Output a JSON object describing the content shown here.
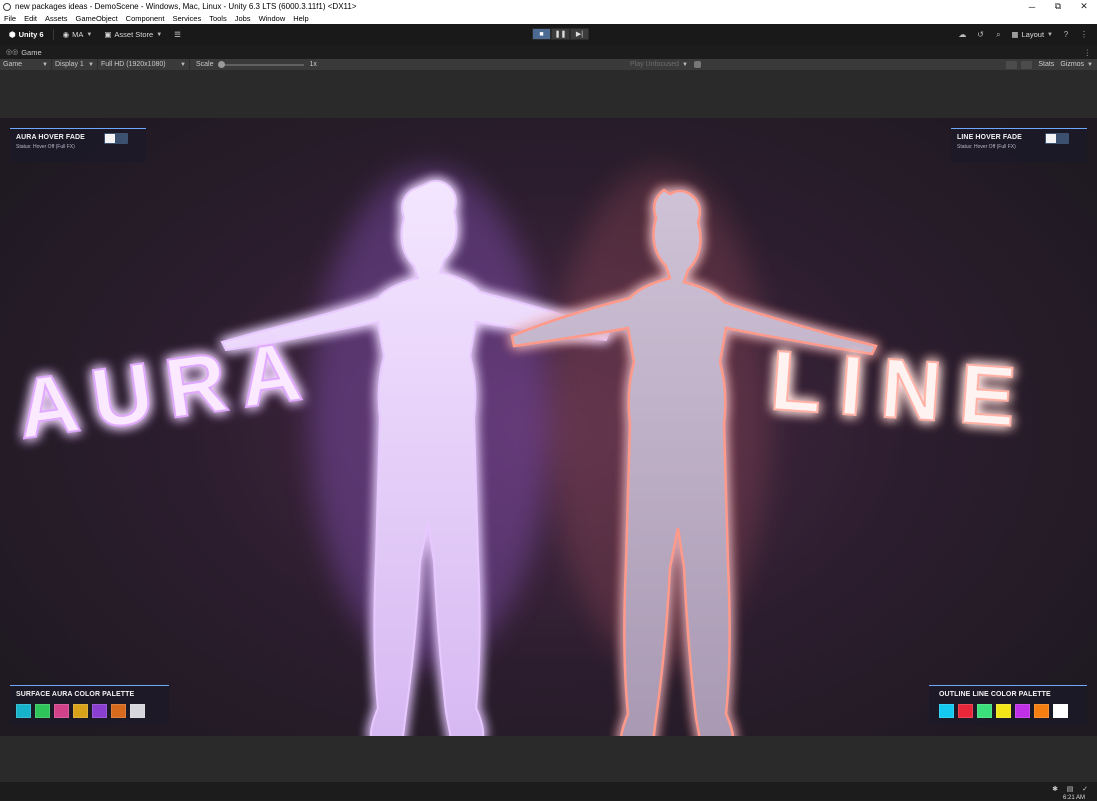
{
  "window": {
    "title": "new packages ideas - DemoScene - Windows, Mac, Linux - Unity 6.3 LTS (6000.3.11f1) <DX11>",
    "minimize_glyph": "─",
    "maximize_glyph": "⧉",
    "close_glyph": "✕"
  },
  "menu": [
    "File",
    "Edit",
    "Assets",
    "GameObject",
    "Component",
    "Services",
    "Tools",
    "Jobs",
    "Window",
    "Help"
  ],
  "toolbar": {
    "unity_label": "Unity 6",
    "account_label": "MA",
    "asset_store_label": "Asset Store",
    "layout_label": "Layout",
    "play_state": "playing"
  },
  "tab": {
    "label": "Game"
  },
  "gamebar": {
    "view_label": "Game",
    "display_label": "Display 1",
    "resolution_label": "Full HD (1920x1080)",
    "scale_label": "Scale",
    "scale_value": "1x",
    "play_mode_label": "Play Unfocused",
    "stats_label": "Stats",
    "gizmos_label": "Gizmos"
  },
  "scene": {
    "left_word": "AURA",
    "right_word": "LINE"
  },
  "panels": {
    "aura_fade": {
      "title": "AURA HOVER FADE",
      "status": "Status: Hover Off (Full FX)",
      "toggle_on": false
    },
    "line_fade": {
      "title": "LINE HOVER FADE",
      "status": "Status: Hover Off (Full FX)",
      "toggle_on": false
    },
    "aura_palette": {
      "title": "SURFACE AURA COLOR PALETTE",
      "colors": [
        "#17b3cc",
        "#2ec45a",
        "#d1428a",
        "#d8a21a",
        "#8a3fd0",
        "#d86a1e",
        "#d6d6dc"
      ]
    },
    "line_palette": {
      "title": "OUTLINE LINE COLOR PALETTE",
      "colors": [
        "#14c9f0",
        "#e8283a",
        "#3be07a",
        "#f2e619",
        "#c030e6",
        "#f57f10",
        "#ffffff"
      ]
    }
  },
  "taskbar": {
    "clock": "6:21 AM"
  },
  "colors": {
    "accent": "#6fa7ff",
    "aura_glow": "#c58cff",
    "line_glow": "#ff8a78"
  }
}
